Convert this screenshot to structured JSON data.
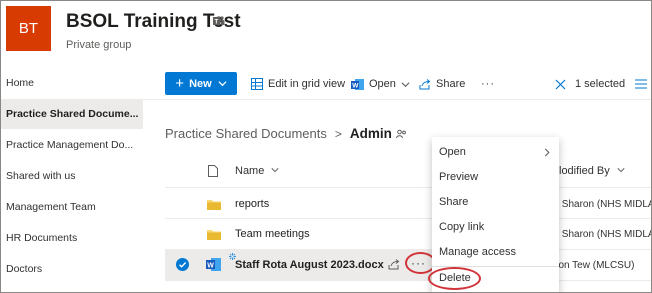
{
  "site": {
    "logo_initials": "BT",
    "title": "BSOL Training Test",
    "subtitle": "Private group"
  },
  "nav": [
    {
      "label": "Home",
      "selected": false
    },
    {
      "label": "Practice Shared Docume...",
      "selected": true
    },
    {
      "label": "Practice Management Do...",
      "selected": false
    },
    {
      "label": "Shared with us",
      "selected": false
    },
    {
      "label": "Management Team",
      "selected": false
    },
    {
      "label": "HR Documents",
      "selected": false
    },
    {
      "label": "Doctors",
      "selected": false
    }
  ],
  "toolbar": {
    "new_label": "New",
    "edit_grid_label": "Edit in grid view",
    "open_label": "Open",
    "share_label": "Share",
    "more_label": "···",
    "selected_label": "1 selected"
  },
  "breadcrumb": {
    "parent": "Practice Shared Documents",
    "separator": ">",
    "current": "Admin"
  },
  "list": {
    "name_header": "Name",
    "modified_by_header": "lodified By",
    "rows": [
      {
        "name": "reports",
        "type": "folder",
        "modified_by": "ew, Sharon (NHS MIDLA"
      },
      {
        "name": "Team meetings",
        "type": "folder",
        "modified_by": "ew, Sharon (NHS MIDLA"
      },
      {
        "name": "Staff Rota August 2023.docx",
        "type": "docx",
        "modified_by": "haron Tew (MLCSU)",
        "selected": true,
        "more": "···"
      }
    ]
  },
  "context_menu": {
    "items": [
      "Open",
      "Preview",
      "Share",
      "Copy link",
      "Manage access",
      "Delete"
    ]
  },
  "colors": {
    "accent": "#0078d4",
    "logo_bg": "#d83b01",
    "annotation": "#d13438",
    "folder": "#f8d775"
  }
}
